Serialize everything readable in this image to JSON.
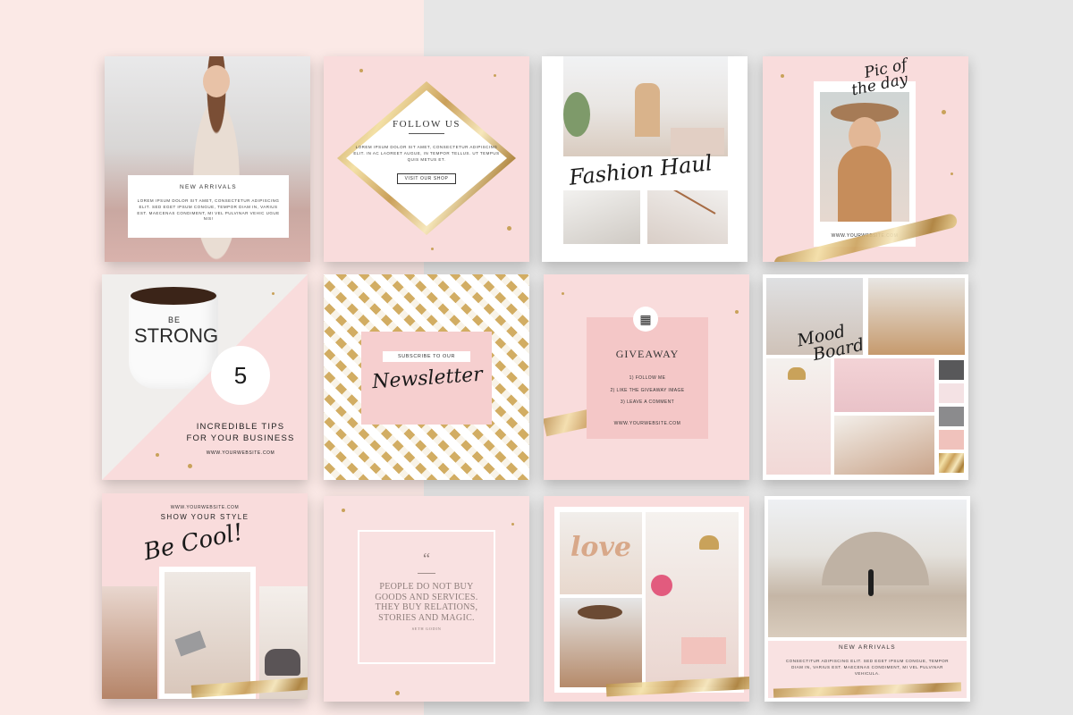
{
  "tiles": {
    "new_arrivals_1": {
      "title": "NEW ARRIVALS",
      "body": "LOREM IPSUM DOLOR SIT AMET, CONSECTETUR ADIPISCING ELIT. SED EGET IPSUM CONGUE, TEMPOR DIAM IN, VARIUS EST. MAECENAS CONDIMENT, MI VEL PULVINAR VEHIC UGUE NIS!"
    },
    "follow_us": {
      "title": "FOLLOW US",
      "body": "LOREM IPSUM DOLOR SIT AMET, CONSECTETUR ADIPISCING ELIT. IN AC LAOREET AUGUE, IN TEMPOR TELLUS. UT TEMPUS QUIS METUS ET.",
      "button": "VISIT OUR SHOP"
    },
    "fashion_haul": {
      "script": "Fashion Haul"
    },
    "pic_of_day": {
      "script_line1": "Pic of",
      "script_line2": "the day",
      "url": "WWW.YOURWEBSITE.COM"
    },
    "tips": {
      "mug_text_top": "BE",
      "mug_text_main": "STRONG",
      "number": "5",
      "line1": "INCREDIBLE TIPS",
      "line2": "FOR YOUR BUSINESS",
      "url": "WWW.YOURWEBSITE.COM"
    },
    "newsletter": {
      "label": "SUBSCRIBE TO OUR",
      "script": "Newsletter"
    },
    "giveaway": {
      "title": "GIVEAWAY",
      "steps": [
        "1) FOLLOW ME",
        "2) LIKE THE GIVEAWAY IMAGE",
        "3) LEAVE A COMMENT"
      ],
      "url": "WWW.YOURWEBSITE.COM"
    },
    "mood_board": {
      "script_line1": "Mood",
      "script_line2": "Board"
    },
    "be_cool": {
      "url": "WWW.YOURWEBSITE.COM",
      "tagline": "SHOW YOUR STYLE",
      "script": "Be Cool!"
    },
    "quote": {
      "mark": "“",
      "text": "PEOPLE DO NOT BUY GOODS AND SERVICES. THEY BUY RELATIONS, STORIES AND MAGIC.",
      "author": "SETH GODIN"
    },
    "love": {
      "balloon": "love"
    },
    "new_arrivals_2": {
      "title": "NEW ARRIVALS",
      "body": "CONSECTITUR ADIPISCING ELIT. SED EGET IPSUM CONGUE, TEMPOR DIAM IN, VARIUS EST. MAECENAS CONDIMENT, MI VEL PULVINAR VEHICULA."
    }
  },
  "colors": {
    "blush": "#f9dcdc",
    "pink_accent": "#f4c7c7",
    "gold": "#c9a25a",
    "left_bg": "#fbe9e6",
    "right_bg": "#e6e6e6"
  },
  "mood_swatches": [
    "#58585a",
    "#f4e2e4",
    "#8b8b8d",
    "#f0c2bc",
    "#d2b56e"
  ]
}
